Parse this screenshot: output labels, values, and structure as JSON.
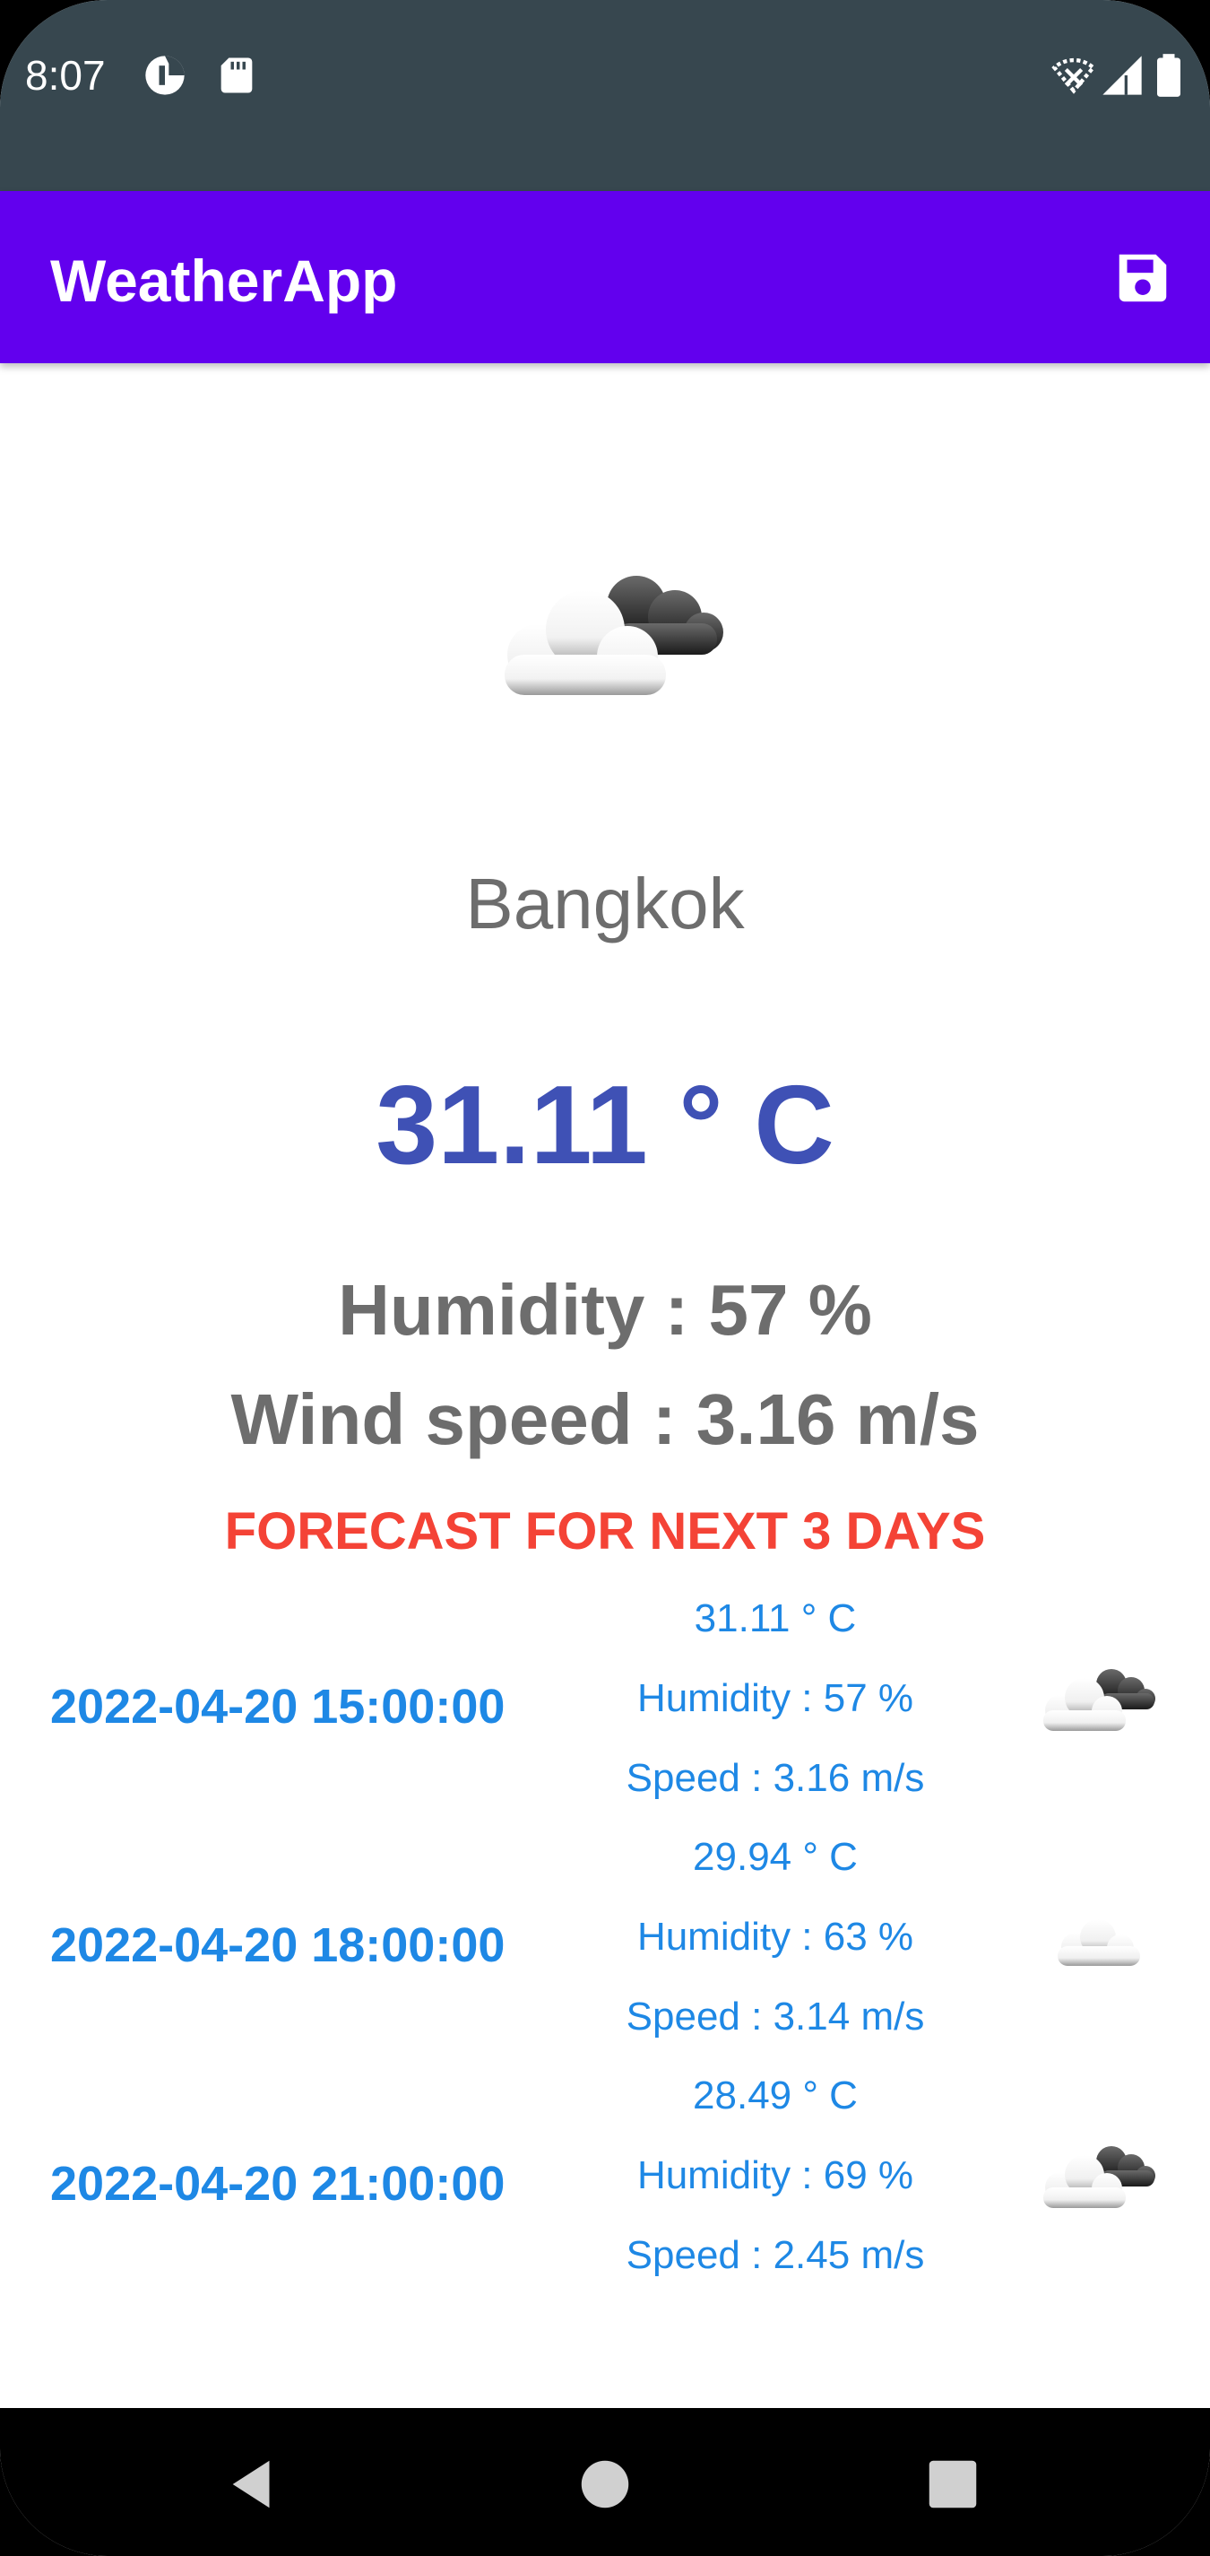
{
  "status_bar": {
    "time": "8:07",
    "icons": [
      "data-saver-icon",
      "sd-card-icon",
      "wifi-off-icon",
      "signal-icon",
      "battery-icon"
    ],
    "background": "#37474f"
  },
  "app_bar": {
    "title": "WeatherApp",
    "action_icon": "save-icon",
    "background": "#6200ee"
  },
  "current": {
    "icon": "partly-cloudy-icon",
    "city": "Bangkok",
    "temperature": "31.11 ° C",
    "humidity": "Humidity : 57 %",
    "wind_speed": "Wind speed : 3.16 m/s"
  },
  "forecast": {
    "title": "FORECAST FOR NEXT 3 DAYS",
    "items": [
      {
        "datetime": "2022-04-20 15:00:00",
        "temperature": "31.11 ° C",
        "humidity": "Humidity : 57 %",
        "speed": "Speed : 3.16 m/s",
        "icon": "partly-cloudy-icon"
      },
      {
        "datetime": "2022-04-20 18:00:00",
        "temperature": "29.94 ° C",
        "humidity": "Humidity : 63 %",
        "speed": "Speed : 3.14 m/s",
        "icon": "cloud-icon"
      },
      {
        "datetime": "2022-04-20 21:00:00",
        "temperature": "28.49 ° C",
        "humidity": "Humidity : 69 %",
        "speed": "Speed : 2.45 m/s",
        "icon": "partly-cloudy-icon"
      }
    ]
  },
  "nav_bar": {
    "buttons": [
      "back-icon",
      "home-icon",
      "recents-icon"
    ]
  },
  "colors": {
    "temperature": "#3f51b5",
    "forecast_title": "#f44336",
    "forecast_text": "#1e88e5",
    "secondary_text": "#6d6d6d"
  }
}
